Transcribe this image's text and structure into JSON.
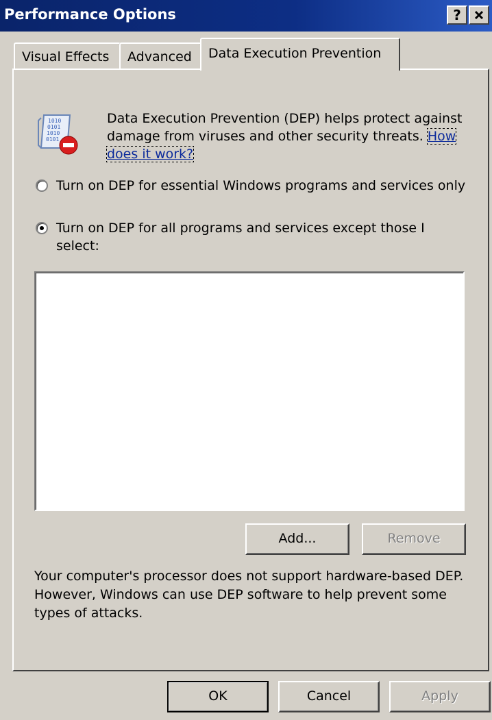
{
  "window": {
    "title": "Performance Options",
    "help_label": "?"
  },
  "tabs": [
    {
      "label": "Visual Effects",
      "selected": false
    },
    {
      "label": "Advanced",
      "selected": false
    },
    {
      "label": "Data Execution Prevention",
      "selected": true
    }
  ],
  "dep": {
    "intro_text": "Data Execution Prevention (DEP) helps protect against damage from viruses and other security threats.",
    "link_text": "How does it work?",
    "options": [
      {
        "label": "Turn on DEP for essential Windows programs and services only",
        "selected": false
      },
      {
        "label": "Turn on DEP for all programs and services except those I select:",
        "selected": true
      }
    ],
    "program_list": [],
    "add_label": "Add...",
    "remove_label": "Remove",
    "processor_note": "Your computer's processor does not support hardware-based DEP. However, Windows can use DEP software to help prevent some types of attacks."
  },
  "footer": {
    "ok_label": "OK",
    "cancel_label": "Cancel",
    "apply_label": "Apply"
  },
  "icons": [
    "dep-shield-binary-icon",
    "close-icon"
  ]
}
